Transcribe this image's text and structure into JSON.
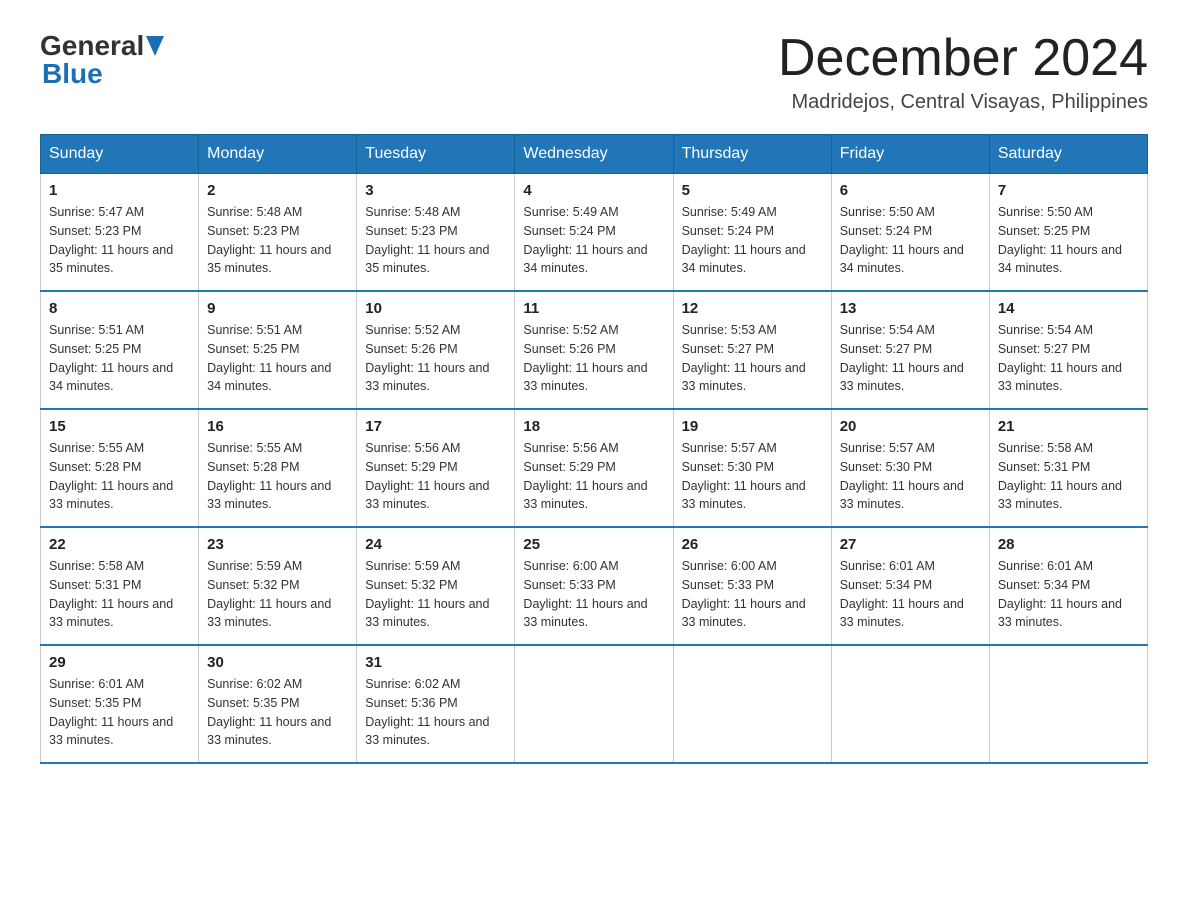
{
  "logo": {
    "general_text": "General",
    "blue_text": "Blue"
  },
  "header": {
    "month_year": "December 2024",
    "location": "Madridejos, Central Visayas, Philippines"
  },
  "weekdays": [
    "Sunday",
    "Monday",
    "Tuesday",
    "Wednesday",
    "Thursday",
    "Friday",
    "Saturday"
  ],
  "weeks": [
    {
      "days": [
        {
          "date": "1",
          "sunrise": "Sunrise: 5:47 AM",
          "sunset": "Sunset: 5:23 PM",
          "daylight": "Daylight: 11 hours and 35 minutes."
        },
        {
          "date": "2",
          "sunrise": "Sunrise: 5:48 AM",
          "sunset": "Sunset: 5:23 PM",
          "daylight": "Daylight: 11 hours and 35 minutes."
        },
        {
          "date": "3",
          "sunrise": "Sunrise: 5:48 AM",
          "sunset": "Sunset: 5:23 PM",
          "daylight": "Daylight: 11 hours and 35 minutes."
        },
        {
          "date": "4",
          "sunrise": "Sunrise: 5:49 AM",
          "sunset": "Sunset: 5:24 PM",
          "daylight": "Daylight: 11 hours and 34 minutes."
        },
        {
          "date": "5",
          "sunrise": "Sunrise: 5:49 AM",
          "sunset": "Sunset: 5:24 PM",
          "daylight": "Daylight: 11 hours and 34 minutes."
        },
        {
          "date": "6",
          "sunrise": "Sunrise: 5:50 AM",
          "sunset": "Sunset: 5:24 PM",
          "daylight": "Daylight: 11 hours and 34 minutes."
        },
        {
          "date": "7",
          "sunrise": "Sunrise: 5:50 AM",
          "sunset": "Sunset: 5:25 PM",
          "daylight": "Daylight: 11 hours and 34 minutes."
        }
      ]
    },
    {
      "days": [
        {
          "date": "8",
          "sunrise": "Sunrise: 5:51 AM",
          "sunset": "Sunset: 5:25 PM",
          "daylight": "Daylight: 11 hours and 34 minutes."
        },
        {
          "date": "9",
          "sunrise": "Sunrise: 5:51 AM",
          "sunset": "Sunset: 5:25 PM",
          "daylight": "Daylight: 11 hours and 34 minutes."
        },
        {
          "date": "10",
          "sunrise": "Sunrise: 5:52 AM",
          "sunset": "Sunset: 5:26 PM",
          "daylight": "Daylight: 11 hours and 33 minutes."
        },
        {
          "date": "11",
          "sunrise": "Sunrise: 5:52 AM",
          "sunset": "Sunset: 5:26 PM",
          "daylight": "Daylight: 11 hours and 33 minutes."
        },
        {
          "date": "12",
          "sunrise": "Sunrise: 5:53 AM",
          "sunset": "Sunset: 5:27 PM",
          "daylight": "Daylight: 11 hours and 33 minutes."
        },
        {
          "date": "13",
          "sunrise": "Sunrise: 5:54 AM",
          "sunset": "Sunset: 5:27 PM",
          "daylight": "Daylight: 11 hours and 33 minutes."
        },
        {
          "date": "14",
          "sunrise": "Sunrise: 5:54 AM",
          "sunset": "Sunset: 5:27 PM",
          "daylight": "Daylight: 11 hours and 33 minutes."
        }
      ]
    },
    {
      "days": [
        {
          "date": "15",
          "sunrise": "Sunrise: 5:55 AM",
          "sunset": "Sunset: 5:28 PM",
          "daylight": "Daylight: 11 hours and 33 minutes."
        },
        {
          "date": "16",
          "sunrise": "Sunrise: 5:55 AM",
          "sunset": "Sunset: 5:28 PM",
          "daylight": "Daylight: 11 hours and 33 minutes."
        },
        {
          "date": "17",
          "sunrise": "Sunrise: 5:56 AM",
          "sunset": "Sunset: 5:29 PM",
          "daylight": "Daylight: 11 hours and 33 minutes."
        },
        {
          "date": "18",
          "sunrise": "Sunrise: 5:56 AM",
          "sunset": "Sunset: 5:29 PM",
          "daylight": "Daylight: 11 hours and 33 minutes."
        },
        {
          "date": "19",
          "sunrise": "Sunrise: 5:57 AM",
          "sunset": "Sunset: 5:30 PM",
          "daylight": "Daylight: 11 hours and 33 minutes."
        },
        {
          "date": "20",
          "sunrise": "Sunrise: 5:57 AM",
          "sunset": "Sunset: 5:30 PM",
          "daylight": "Daylight: 11 hours and 33 minutes."
        },
        {
          "date": "21",
          "sunrise": "Sunrise: 5:58 AM",
          "sunset": "Sunset: 5:31 PM",
          "daylight": "Daylight: 11 hours and 33 minutes."
        }
      ]
    },
    {
      "days": [
        {
          "date": "22",
          "sunrise": "Sunrise: 5:58 AM",
          "sunset": "Sunset: 5:31 PM",
          "daylight": "Daylight: 11 hours and 33 minutes."
        },
        {
          "date": "23",
          "sunrise": "Sunrise: 5:59 AM",
          "sunset": "Sunset: 5:32 PM",
          "daylight": "Daylight: 11 hours and 33 minutes."
        },
        {
          "date": "24",
          "sunrise": "Sunrise: 5:59 AM",
          "sunset": "Sunset: 5:32 PM",
          "daylight": "Daylight: 11 hours and 33 minutes."
        },
        {
          "date": "25",
          "sunrise": "Sunrise: 6:00 AM",
          "sunset": "Sunset: 5:33 PM",
          "daylight": "Daylight: 11 hours and 33 minutes."
        },
        {
          "date": "26",
          "sunrise": "Sunrise: 6:00 AM",
          "sunset": "Sunset: 5:33 PM",
          "daylight": "Daylight: 11 hours and 33 minutes."
        },
        {
          "date": "27",
          "sunrise": "Sunrise: 6:01 AM",
          "sunset": "Sunset: 5:34 PM",
          "daylight": "Daylight: 11 hours and 33 minutes."
        },
        {
          "date": "28",
          "sunrise": "Sunrise: 6:01 AM",
          "sunset": "Sunset: 5:34 PM",
          "daylight": "Daylight: 11 hours and 33 minutes."
        }
      ]
    },
    {
      "days": [
        {
          "date": "29",
          "sunrise": "Sunrise: 6:01 AM",
          "sunset": "Sunset: 5:35 PM",
          "daylight": "Daylight: 11 hours and 33 minutes."
        },
        {
          "date": "30",
          "sunrise": "Sunrise: 6:02 AM",
          "sunset": "Sunset: 5:35 PM",
          "daylight": "Daylight: 11 hours and 33 minutes."
        },
        {
          "date": "31",
          "sunrise": "Sunrise: 6:02 AM",
          "sunset": "Sunset: 5:36 PM",
          "daylight": "Daylight: 11 hours and 33 minutes."
        },
        null,
        null,
        null,
        null
      ]
    }
  ]
}
